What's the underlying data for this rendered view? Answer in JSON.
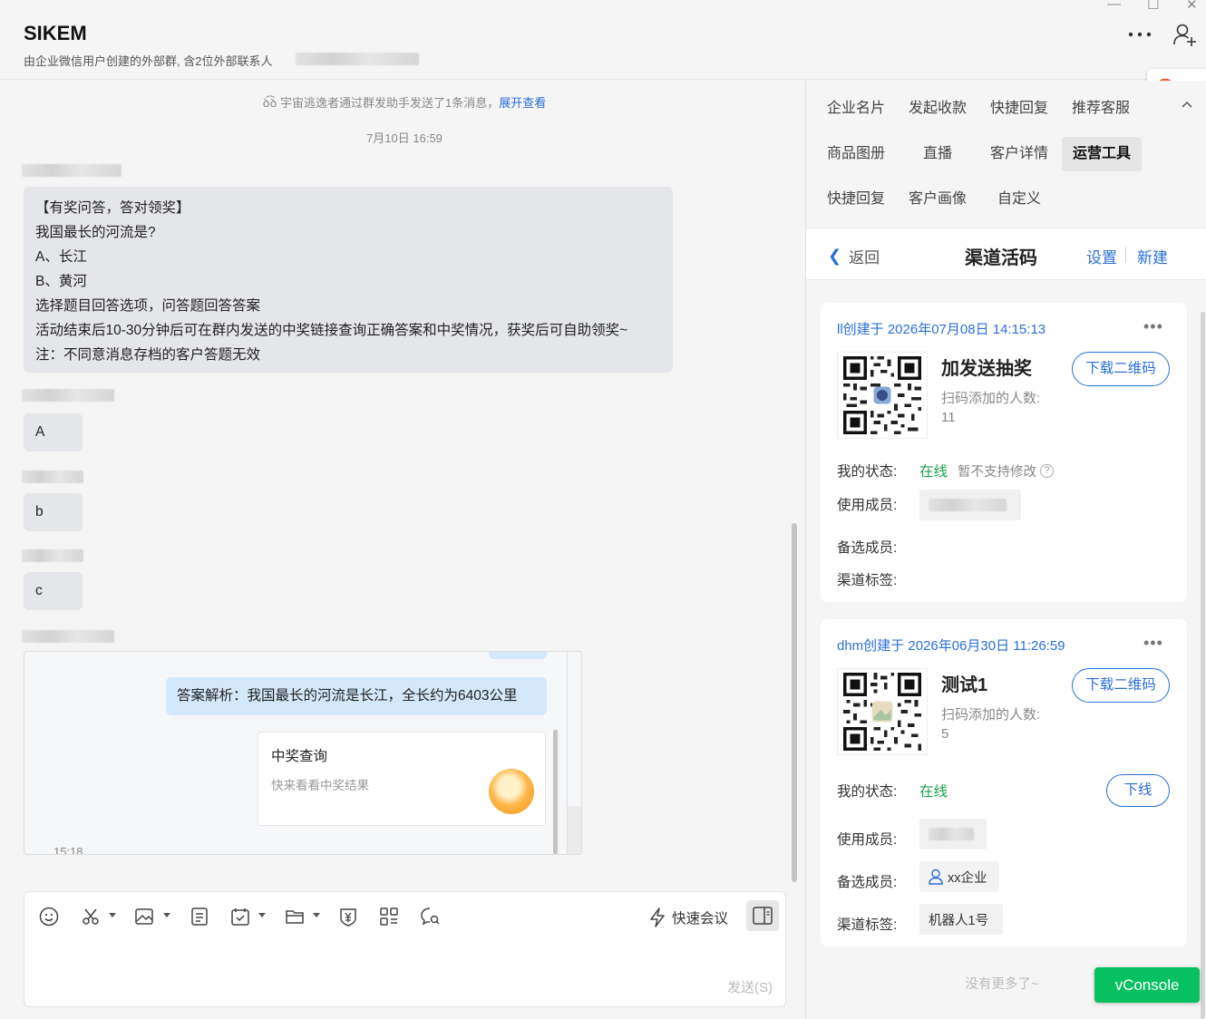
{
  "header": {
    "title": "SIKEM",
    "subtitle": "由企业微信用户创建的外部群, 含2位外部联系人",
    "window_controls": [
      "—",
      "☐",
      "✕"
    ]
  },
  "chat": {
    "system_notice": "ꝺ͡ꝺ 宇宙逃逸者通过群发助手发送了1条消息，",
    "system_notice_link": "展开查看",
    "timestamp": "7月10日 16:59",
    "quiz_lines": [
      "【有奖问答，答对领奖】",
      "我国最长的河流是?",
      "A、长江",
      "B、黄河",
      "选择题目回答选项，问答题回答答案",
      "活动结束后10-30分钟后可在群内发送的中奖链接查询正确答案和中奖情况，获奖后可自助领奖~",
      "注：不同意消息存档的客户答题无效"
    ],
    "replies": [
      "A",
      "b",
      "c"
    ],
    "answer_text": "答案解析：我国最长的河流是长江，全长约为6403公里",
    "card_title": "中奖查询",
    "card_desc": "快来看看中奖结果",
    "embed_time": "15:18"
  },
  "composer": {
    "tools": [
      "emoji-icon",
      "scissors-icon",
      "image-icon",
      "document-icon",
      "calendar-check-icon",
      "folder-icon",
      "payment-icon",
      "apps-grid-icon",
      "chat-search-icon"
    ],
    "quick_meeting": "快速会议",
    "send_label": "发送(S)"
  },
  "side": {
    "tabs": [
      "企业名片",
      "发起收款",
      "快捷回复",
      "推荐客服",
      "商品图册",
      "直播",
      "客户详情",
      "运营工具",
      "快捷回复",
      "客户画像",
      "自定义"
    ],
    "active_tab": "运营工具",
    "back_label": "返回",
    "page_title": "渠道活码",
    "settings_label": "设置",
    "new_label": "新建",
    "labels": {
      "my_status": "我的状态:",
      "members": "使用成员:",
      "backup_members": "备选成员:",
      "channel_tags": "渠道标签:",
      "scan_count": "扫码添加的人数:"
    },
    "cards": [
      {
        "created": "ll创建于 2026年07月08日 14:15:13",
        "name": "加发送抽奖",
        "scan_count": "11",
        "download_label": "下载二维码",
        "status": "在线",
        "status_note": "暂不支持修改",
        "backup_member": "",
        "tag": ""
      },
      {
        "created": "dhm创建于 2026年06月30日 11:26:59",
        "name": "测试1",
        "scan_count": "5",
        "download_label": "下载二维码",
        "status": "在线",
        "offline_label": "下线",
        "backup_member": "xx企业",
        "tag": "机器人1号"
      }
    ],
    "no_more": "没有更多了~"
  },
  "vconsole": "vConsole",
  "colors": {
    "accent": "#2b6fd6",
    "online": "#1aa04b",
    "vconsole": "#07c160",
    "answer_bubble": "#d3e8fb"
  }
}
